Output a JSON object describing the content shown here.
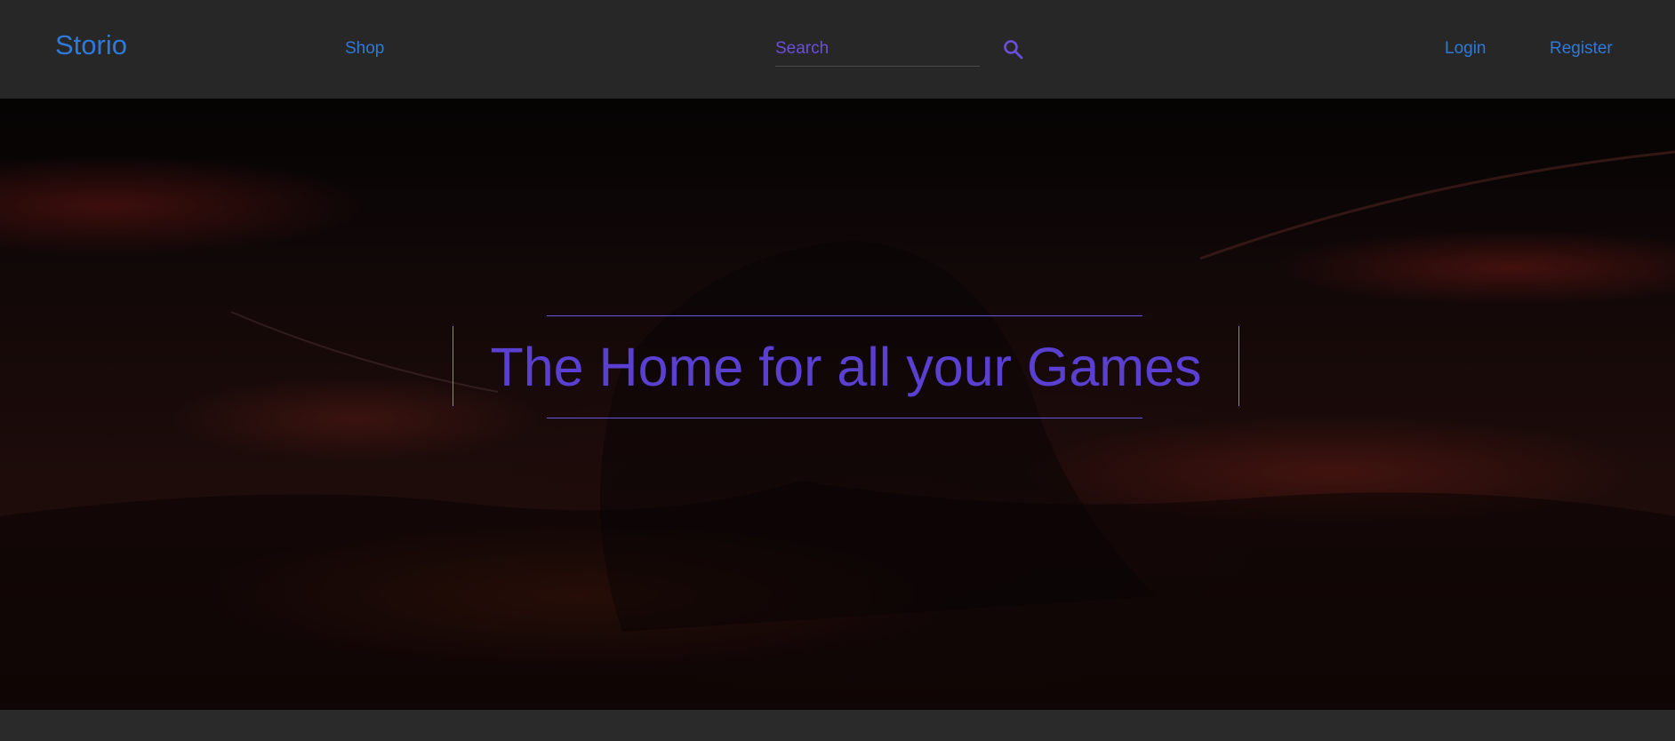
{
  "navbar": {
    "brand": "Storio",
    "shop_label": "Shop",
    "search": {
      "placeholder": "Search",
      "value": ""
    },
    "login_label": "Login",
    "register_label": "Register"
  },
  "hero": {
    "title": "The Home for all your Games"
  },
  "colors": {
    "link": "#2f7ad8",
    "accent": "#5a3fd0",
    "navbar_bg": "#272727"
  },
  "icons": {
    "search": "search-icon"
  }
}
